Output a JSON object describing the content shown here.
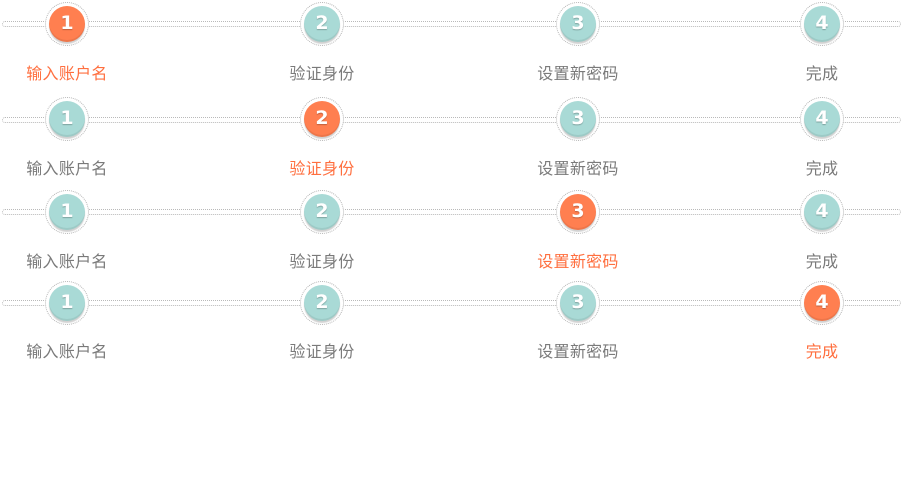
{
  "colors": {
    "active": "#ff7f50",
    "inactive": "#a9dad6",
    "label_active": "#ff6f3f",
    "label_inactive": "#7a7a7a"
  },
  "steppers": [
    {
      "active_step": 1,
      "steps": [
        {
          "number": "1",
          "label": "输入账户名"
        },
        {
          "number": "2",
          "label": "验证身份"
        },
        {
          "number": "3",
          "label": "设置新密码"
        },
        {
          "number": "4",
          "label": "完成"
        }
      ]
    },
    {
      "active_step": 2,
      "steps": [
        {
          "number": "1",
          "label": "输入账户名"
        },
        {
          "number": "2",
          "label": "验证身份"
        },
        {
          "number": "3",
          "label": "设置新密码"
        },
        {
          "number": "4",
          "label": "完成"
        }
      ]
    },
    {
      "active_step": 3,
      "steps": [
        {
          "number": "1",
          "label": "输入账户名"
        },
        {
          "number": "2",
          "label": "验证身份"
        },
        {
          "number": "3",
          "label": "设置新密码"
        },
        {
          "number": "4",
          "label": "完成"
        }
      ]
    },
    {
      "active_step": 4,
      "steps": [
        {
          "number": "1",
          "label": "输入账户名"
        },
        {
          "number": "2",
          "label": "验证身份"
        },
        {
          "number": "3",
          "label": "设置新密码"
        },
        {
          "number": "4",
          "label": "完成"
        }
      ]
    }
  ]
}
